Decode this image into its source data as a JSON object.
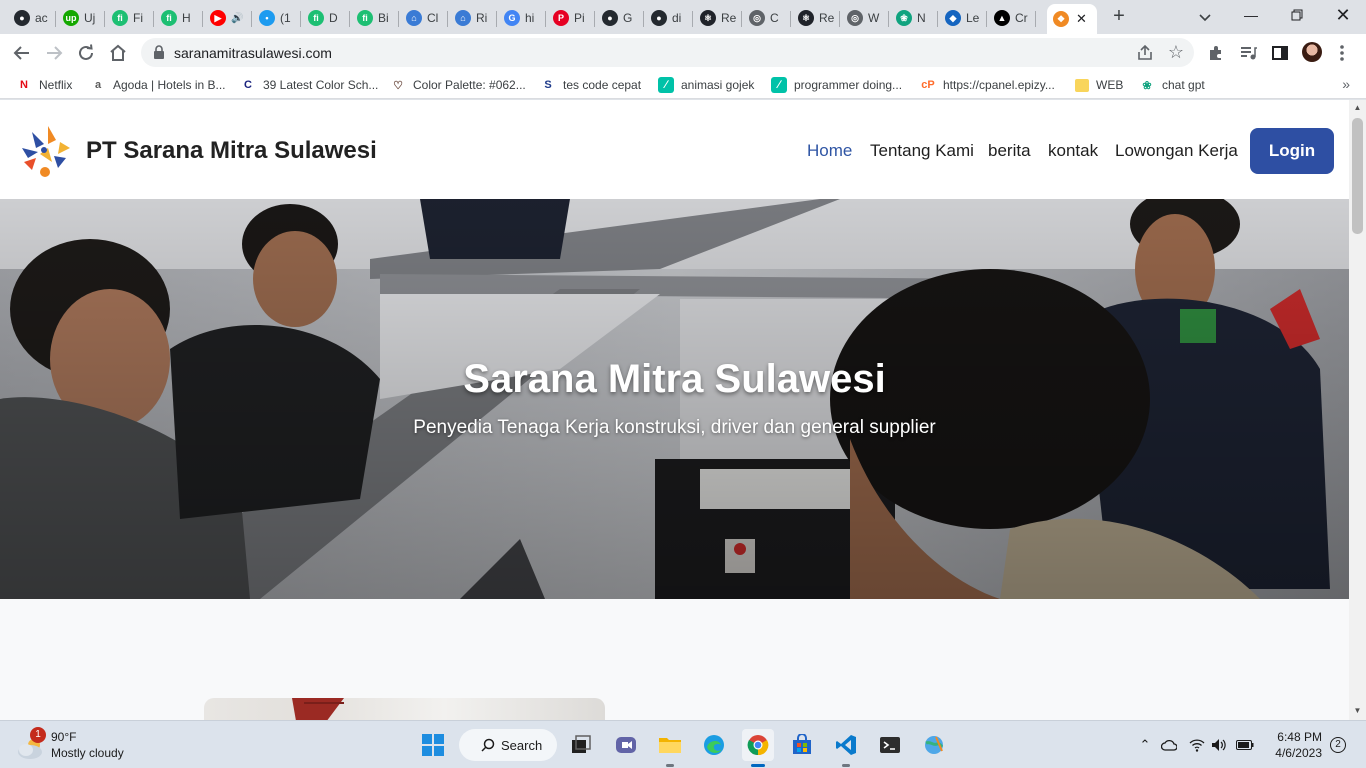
{
  "browser": {
    "tabs": [
      {
        "label": "ac",
        "icon": "github-icon",
        "color": "#24292f"
      },
      {
        "label": "Uj",
        "icon": "upwork-icon",
        "color": "#14a800"
      },
      {
        "label": "Fi",
        "icon": "fiverr-icon",
        "color": "#1dbf73"
      },
      {
        "label": "H",
        "icon": "fiverr-icon",
        "color": "#1dbf73"
      },
      {
        "label": "",
        "icon": "youtube-icon",
        "color": "#ff0000"
      },
      {
        "label": "(1",
        "icon": "twitter-icon",
        "color": "#1d9bf0"
      },
      {
        "label": "D",
        "icon": "fiverr-icon",
        "color": "#1dbf73"
      },
      {
        "label": "Bi",
        "icon": "fiverr-icon",
        "color": "#1dbf73"
      },
      {
        "label": "Cl",
        "icon": "house-icon",
        "color": "#3a7bd5"
      },
      {
        "label": "Ri",
        "icon": "house-icon",
        "color": "#3a7bd5"
      },
      {
        "label": "hi",
        "icon": "google-icon",
        "color": "#4285f4"
      },
      {
        "label": "Pi",
        "icon": "pinterest-icon",
        "color": "#e60023"
      },
      {
        "label": "G",
        "icon": "github-icon",
        "color": "#24292f"
      },
      {
        "label": "di",
        "icon": "github-icon",
        "color": "#24292f"
      },
      {
        "label": "Re",
        "icon": "react-icon",
        "color": "#20232a"
      },
      {
        "label": "C",
        "icon": "globe-icon",
        "color": "#5f6368"
      },
      {
        "label": "Re",
        "icon": "react-icon",
        "color": "#20232a"
      },
      {
        "label": "W",
        "icon": "globe-icon",
        "color": "#5f6368"
      },
      {
        "label": "N",
        "icon": "chatgpt-icon",
        "color": "#10a37f"
      },
      {
        "label": "Le",
        "icon": "drop-icon",
        "color": "#1565c0"
      },
      {
        "label": "Cr",
        "icon": "triangle-icon",
        "color": "#000000"
      },
      {
        "label": "",
        "icon": "sms-logo-icon",
        "color": "#f08a24",
        "active": true
      }
    ],
    "url": "saranamitrasulawesi.com",
    "bookmarks": [
      {
        "label": "Netflix",
        "icon": "netflix-icon",
        "color": "#e50914",
        "glyph": "N"
      },
      {
        "label": "Agoda | Hotels in B...",
        "icon": "agoda-icon",
        "color": "#5c5c5c",
        "glyph": "a"
      },
      {
        "label": "39 Latest Color Sch...",
        "icon": "colorscheme-icon",
        "color": "#1a237e",
        "glyph": "C"
      },
      {
        "label": "Color Palette: #062...",
        "icon": "palette-icon",
        "color": "#6d4c41",
        "glyph": "♡"
      },
      {
        "label": "tes code cepat",
        "icon": "s-logo-icon",
        "color": "#1e3a8a",
        "glyph": "S"
      },
      {
        "label": "animasi gojek",
        "icon": "pen-icon",
        "color": "#00c2a8",
        "glyph": "∕"
      },
      {
        "label": "programmer doing...",
        "icon": "pen-icon",
        "color": "#00c2a8",
        "glyph": "∕"
      },
      {
        "label": "https://cpanel.epizy...",
        "icon": "cpanel-icon",
        "color": "#ff6c2c",
        "glyph": "cP"
      },
      {
        "label": "WEB",
        "icon": "folder-icon",
        "color": "#f9d55b",
        "glyph": ""
      },
      {
        "label": "chat gpt",
        "icon": "chatgpt-icon",
        "color": "#10a37f",
        "glyph": "❀"
      }
    ]
  },
  "site": {
    "brand": "PT Sarana Mitra Sulawesi",
    "nav": {
      "home": "Home",
      "about": "Tentang Kami",
      "news": "berita",
      "contact": "kontak",
      "jobs": "Lowongan Kerja",
      "login": "Login"
    },
    "hero": {
      "title": "Sarana Mitra Sulawesi",
      "subtitle": "Penyedia Tenaga Kerja konstruksi, driver dan general supplier"
    },
    "colors": {
      "accent": "#2e4fa3",
      "nav_active": "#2f55a4"
    }
  },
  "taskbar": {
    "weather_temp": "90°F",
    "weather_cond": "Mostly cloudy",
    "weather_badge": "1",
    "search_label": "Search",
    "time": "6:48 PM",
    "date": "4/6/2023",
    "notifications": "2"
  }
}
